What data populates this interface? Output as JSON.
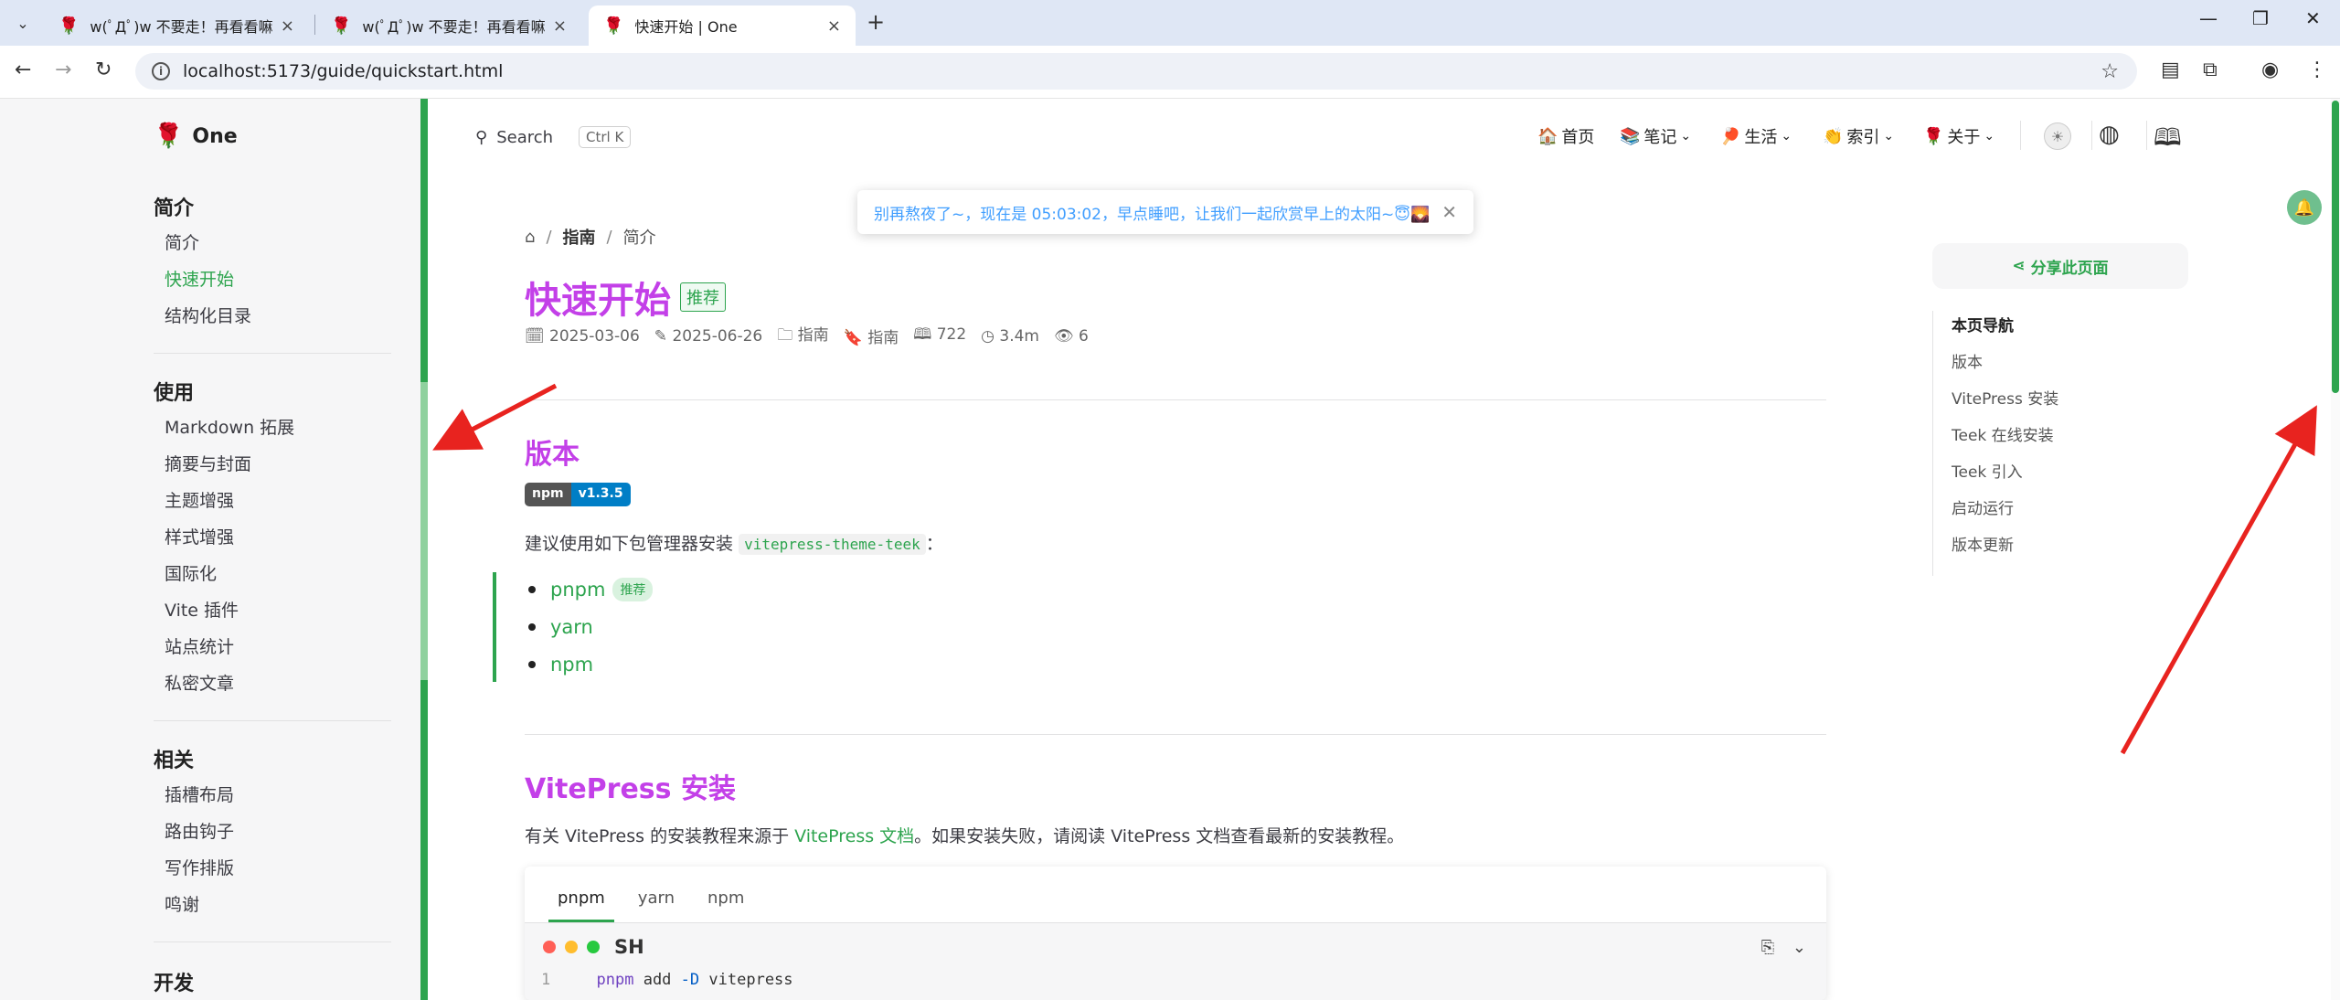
{
  "browser": {
    "tabs": [
      {
        "title": "w(ﾟДﾟ)w 不要走！再看看嘛！",
        "favicon": "rose-icon"
      },
      {
        "title": "w(ﾟДﾟ)w 不要走！再看看嘛！",
        "favicon": "rose-icon"
      },
      {
        "title": "快速开始 | One",
        "favicon": "rose-icon"
      }
    ],
    "url": "localhost:5173/guide/quickstart.html"
  },
  "site": {
    "brand": "One",
    "search_label": "Search",
    "search_kbd": "Ctrl K",
    "nav": [
      "首页",
      "笔记",
      "生活",
      "索引",
      "关于"
    ]
  },
  "sidebar": {
    "sections": [
      {
        "title": "简介",
        "items": [
          "简介",
          "快速开始",
          "结构化目录"
        ]
      },
      {
        "title": "使用",
        "items": [
          "Markdown 拓展",
          "摘要与封面",
          "主题增强",
          "样式增强",
          "国际化",
          "Vite 插件",
          "站点统计",
          "私密文章"
        ]
      },
      {
        "title": "相关",
        "items": [
          "插槽布局",
          "路由钩子",
          "写作排版",
          "鸣谢"
        ]
      },
      {
        "title": "开发",
        "items": []
      }
    ],
    "active_item": "快速开始"
  },
  "toast": {
    "text": "别再熬夜了~，现在是 05:03:02，早点睡吧，让我们一起欣赏早上的太阳~😇🌄"
  },
  "page": {
    "breadcrumb": [
      "指南",
      "简介"
    ],
    "title": "快速开始",
    "title_tag": "推荐",
    "meta": {
      "created": "2025-03-06",
      "updated": "2025-06-26",
      "category": "指南",
      "tag": "指南",
      "words": "722",
      "read_time": "3.4m",
      "views": "6"
    },
    "sections": {
      "version": {
        "heading": "版本",
        "badge_left": "npm",
        "badge_right": "v1.3.5",
        "intro_text": "建议使用如下包管理器安装",
        "intro_code": "vitepress-theme-teek",
        "intro_colon": "：",
        "managers": [
          "pnpm",
          "yarn",
          "npm"
        ],
        "recommend_label": "推荐"
      },
      "vitepress": {
        "heading": "VitePress 安装",
        "text_a": "有关 VitePress 的安装教程来源于 ",
        "link": "VitePress 文档",
        "text_b": "。如果安装失败，请阅读 VitePress 文档查看最新的安装教程。",
        "code_tabs": [
          "pnpm",
          "yarn",
          "npm"
        ],
        "code_lang": "SH",
        "code_line_no": "1",
        "code_cmd": "pnpm",
        "code_sub": "add",
        "code_flag": "-D",
        "code_pkg": "vitepress"
      }
    }
  },
  "aside": {
    "share_label": "分享此页面",
    "toc_title": "本页导航",
    "toc": [
      "版本",
      "VitePress 安装",
      "Teek 在线安装",
      "Teek 引入",
      "启动运行",
      "版本更新"
    ]
  },
  "colors": {
    "accent": "#2da44e",
    "heading": "#c340e8",
    "toast": "#409eff"
  }
}
